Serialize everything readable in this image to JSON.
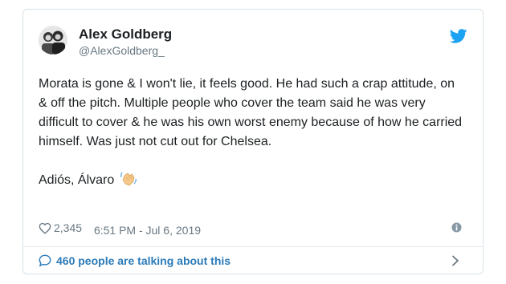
{
  "tweet": {
    "author": {
      "display_name": "Alex Goldberg",
      "handle": "@AlexGoldberg_",
      "avatar_icon": "avatar-photo"
    },
    "platform_icon": "twitter-bird-icon",
    "text_paragraph_1": "Morata is gone & I won't lie, it feels good. He had such a crap attitude, on & off the pitch. Multiple people who cover the team said he was very difficult to cover & he was his own worst enemy because of how he carried himself. Was just not cut out for Chelsea.",
    "text_paragraph_2": "Adiós, Álvaro",
    "emoji": "waving-hand-icon",
    "likes": "2,345",
    "timestamp": "6:51 PM - Jul 6, 2019",
    "conversation": "460 people are talking about this",
    "colors": {
      "accent": "#1da1f2",
      "link": "#2b7bb9",
      "text": "#1c2022",
      "muted": "#697882",
      "border": "#d9e1e8"
    }
  }
}
